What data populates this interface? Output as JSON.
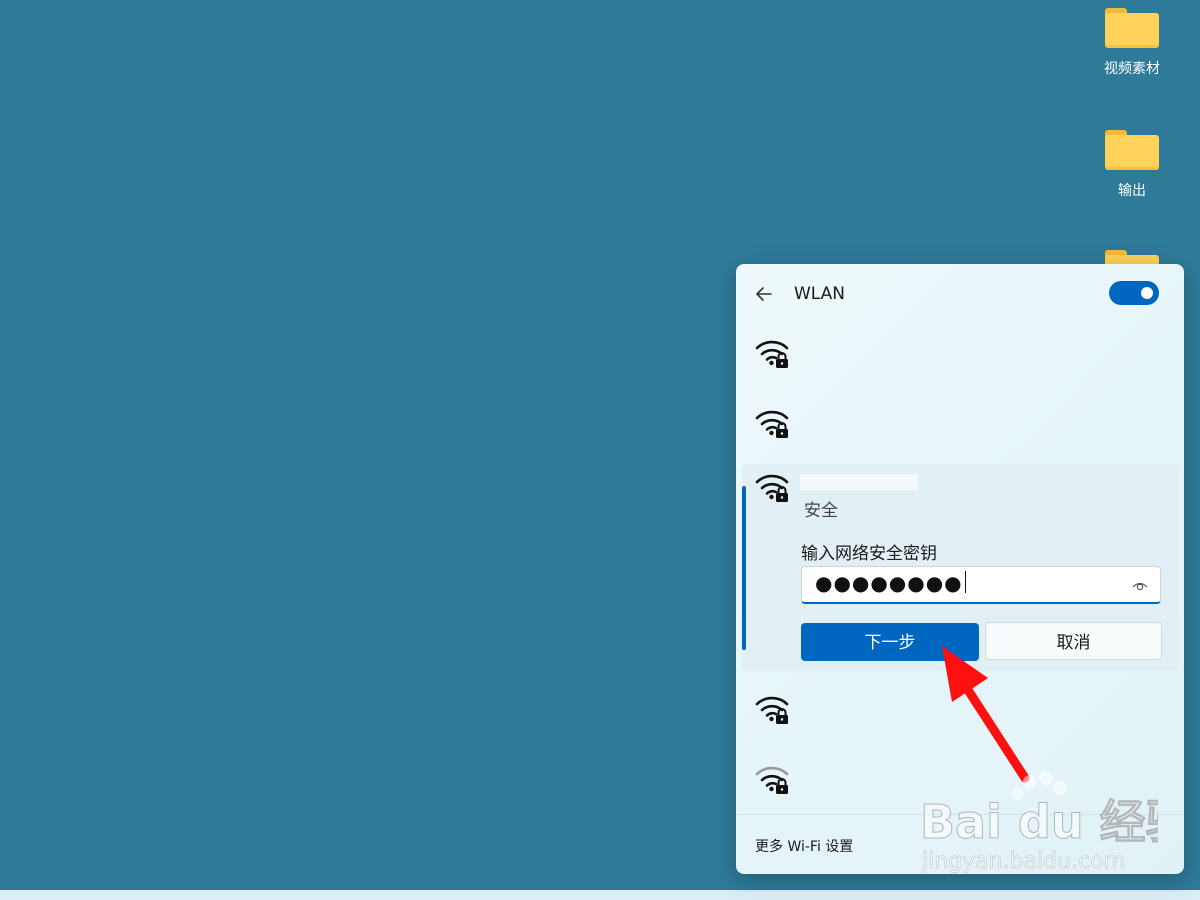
{
  "desktop": {
    "icons": [
      {
        "label": "视频素材"
      },
      {
        "label": "输出"
      }
    ]
  },
  "wlan_panel": {
    "title": "WLAN",
    "toggle_on": true,
    "networks": [
      {
        "secured": true
      },
      {
        "secured": true
      },
      {
        "secured": true,
        "expanded": true,
        "status": "安全"
      },
      {
        "secured": true
      },
      {
        "secured": true
      }
    ],
    "key_prompt": "输入网络安全密钥",
    "password_masked": "●●●●●●●●",
    "next_button": "下一步",
    "cancel_button": "取消",
    "more_settings": "更多 Wi-Fi 设置"
  },
  "colors": {
    "desktop_bg": "#2e7b99",
    "accent": "#0067c0",
    "annotation_arrow": "#ff1010"
  },
  "watermark": {
    "brand": "Bai du 经验",
    "url": "jingyan.baidu.com"
  }
}
